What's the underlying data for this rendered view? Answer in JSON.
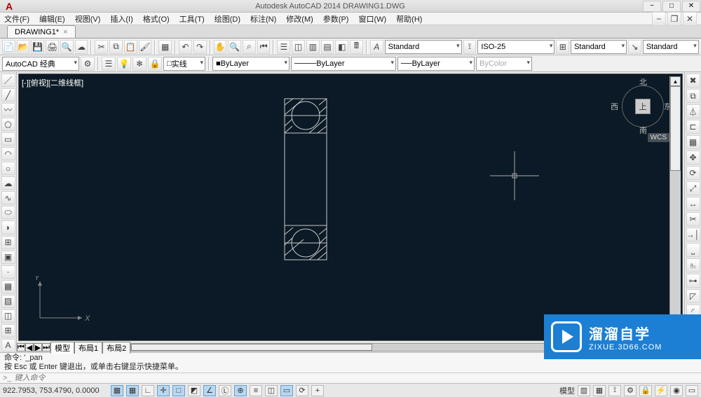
{
  "title": "Autodesk AutoCAD 2014   DRAWING1.DWG",
  "menu": [
    "文件(F)",
    "编辑(E)",
    "视图(V)",
    "插入(I)",
    "格式(O)",
    "工具(T)",
    "绘图(D)",
    "标注(N)",
    "修改(M)",
    "参数(P)",
    "窗口(W)",
    "帮助(H)"
  ],
  "docTab": {
    "label": "DRAWING1*",
    "close": "×"
  },
  "workspace": "AutoCAD 经典",
  "linetype_box": "实线",
  "ddA": "Standard",
  "ddB": "ISO-25",
  "ddC": "Standard",
  "ddD": "Standard",
  "bylayer1": "ByLayer",
  "bylayer2": "ByLayer",
  "bylayer3": "ByLayer",
  "bycolor": "ByColor",
  "viewlabel": "[-][俯视][二维线框]",
  "compass": {
    "n": "北",
    "s": "南",
    "e": "东",
    "w": "西",
    "cube": "上"
  },
  "wcs": "WCS",
  "ucs": {
    "x": "X",
    "y": "Y"
  },
  "modelTabs": [
    "模型",
    "布局1",
    "布局2"
  ],
  "cmd": {
    "l1": "命令: '_pan",
    "l2": "按 Esc 或 Enter 键退出，或单击右键显示快捷菜单。",
    "prompt": ">_",
    "placeholder": "键入命令"
  },
  "coords": "922.7953, 753.4790, 0.0000",
  "status_mode": "模型",
  "brand": {
    "t1": "溜溜自学",
    "t2": "ZIXUE.3D66.COM"
  }
}
